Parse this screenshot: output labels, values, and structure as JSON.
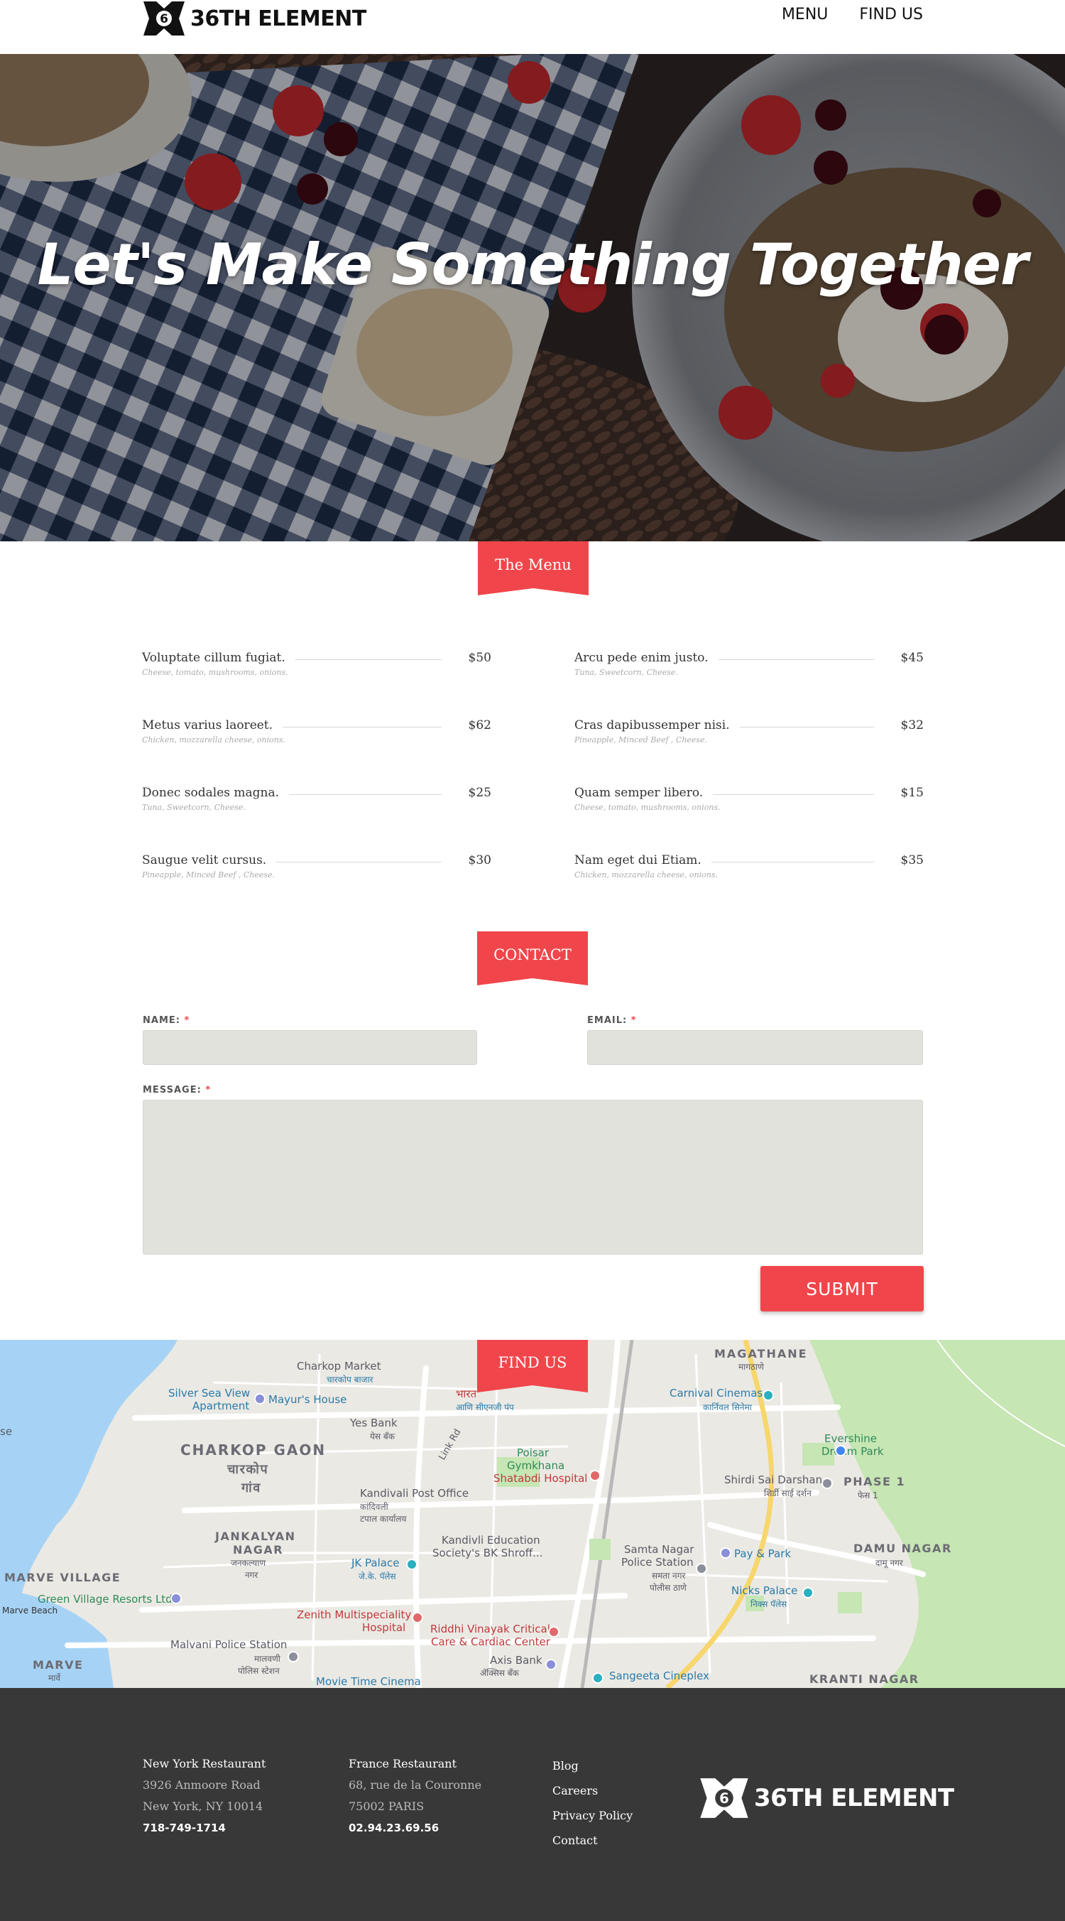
{
  "header": {
    "brand": "36TH ELEMENT",
    "nav": [
      {
        "label": "MENU"
      },
      {
        "label": "FIND US"
      }
    ]
  },
  "hero": {
    "title": "Let's Make Something Together"
  },
  "menu_section": {
    "tab_label": "The Menu",
    "items": [
      {
        "name": "Voluptate cillum fugiat.",
        "desc": "Cheese, tomato, mushrooms, onions.",
        "price": "$50"
      },
      {
        "name": "Arcu pede enim justo.",
        "desc": "Tuna, Sweetcorn, Cheese.",
        "price": "$45"
      },
      {
        "name": "Metus varius laoreet.",
        "desc": "Chicken, mozzarella cheese, onions.",
        "price": "$62"
      },
      {
        "name": "Cras dapibussemper nisi.",
        "desc": "Pineapple, Minced Beef , Cheese.",
        "price": "$32"
      },
      {
        "name": "Donec sodales magna.",
        "desc": "Tuna, Sweetcorn, Cheese.",
        "price": "$25"
      },
      {
        "name": "Quam semper libero.",
        "desc": "Cheese, tomato, mushrooms, onions.",
        "price": "$15"
      },
      {
        "name": "Saugue velit cursus.",
        "desc": "Pineapple, Minced Beef , Cheese.",
        "price": "$30"
      },
      {
        "name": "Nam eget dui Etiam.",
        "desc": "Chicken, mozzarella cheese, onions.",
        "price": "$35"
      }
    ]
  },
  "contact": {
    "tab_label": "CONTACT",
    "name_label": "NAME:",
    "email_label": "EMAIL:",
    "message_label": "MESSAGE:",
    "required_mark": "*",
    "submit_label": "SUBMIT"
  },
  "map": {
    "tab_label": "FIND US",
    "labels": {
      "magathane": "MAGATHANE",
      "magathane_dev": "मागठाणे",
      "charkop_market": "Charkop Market",
      "charkop_market_dev": "चारकोप बाजार",
      "silver_sea": "Silver Sea View",
      "silver_sea_2": "Apartment",
      "mayurs_house": "Mayur's House",
      "bharat": "भारत",
      "aapli": "आणि सीएनजी पंप",
      "yes_bank": "Yes Bank",
      "yes_bank_dev": "येस बँक",
      "link_rd": "Link Rd",
      "charkop_gaon": "CHARKOP GAON",
      "charkop_gaon_dev": "चारकोप",
      "charkop_gaon_dev2": "गांव",
      "poisar": "Poisar",
      "gymkhana": "Gymkhana",
      "shatabdi": "Shatabdi Hospital",
      "carnival": "Carnival Cinemas",
      "carnival_dev": "कार्निवल सिनेमा",
      "evershine": "Evershine",
      "evershine_2": "Dream Park",
      "shirdi": "Shirdi Sai Darshan",
      "shirdi_dev": "शिर्डी साई दर्शन",
      "phase1": "PHASE 1",
      "phase1_dev": "फेस 1",
      "kandivali_po": "Kandivali Post Office",
      "kandivali_po_dev": "कांदिवली",
      "kandivali_po_dev2": "टपाल कार्यालय",
      "jankalyan": "JANKALYAN",
      "nagar": "NAGAR",
      "jankalyan_dev": "जनकल्याण",
      "nagar_dev": "नगर",
      "kandivli_edu": "Kandivli Education",
      "kandivli_edu_2": "Society's BK Shroff...",
      "samta": "Samta Nagar",
      "samta_2": "Police Station",
      "samta_dev": "समता नगर",
      "samta_dev2": "पोलीस ठाणे",
      "pay_park": "Pay & Park",
      "damu": "DAMU NAGAR",
      "damu_dev": "दामू नगर",
      "jk_palace": "JK Palace",
      "jk_palace_dev": "जे.के. पॅलेस",
      "marve_village": "MARVE VILLAGE",
      "green_village": "Green Village Resorts Ltd",
      "marve_beach": "Marve Beach",
      "nicks": "Nicks Palace",
      "nicks_dev": "निक्स पॅलेस",
      "zenith": "Zenith Multispeciality",
      "zenith_2": "Hospital",
      "riddhi": "Riddhi Vinayak Critical",
      "riddhi_2": "Care & Cardiac Center",
      "malvani": "Malvani Police Station",
      "malvani_dev": "मालवणी",
      "malvani_dev2": "पोलिस स्टेशन",
      "axis": "Axis Bank",
      "axis_dev": "ॲक्सिस बँक",
      "marve": "MARVE",
      "marve_dev": "मार्वे",
      "sangeeta": "Sangeeta Cineplex",
      "krantinagar": "KRANTI NAGAR",
      "movie_time": "Movie Time Cinema",
      "se": "se"
    }
  },
  "footer": {
    "ny": {
      "head": "New York Restaurant",
      "line1": "3926 Anmoore Road",
      "line2": "New York, NY 10014",
      "phone": "718-749-1714"
    },
    "fr": {
      "head": "France Restaurant",
      "line1": "68, rue  de la Couronne",
      "line2": "75002 PARIS",
      "phone": "02.94.23.69.56"
    },
    "links": [
      {
        "label": "Blog"
      },
      {
        "label": "Careers"
      },
      {
        "label": "Privacy Policy"
      },
      {
        "label": "Contact"
      }
    ],
    "brand": "36TH ELEMENT"
  },
  "colors": {
    "accent": "#f0464b",
    "footer_bg": "#383838",
    "input_bg": "#e2e2dd"
  }
}
